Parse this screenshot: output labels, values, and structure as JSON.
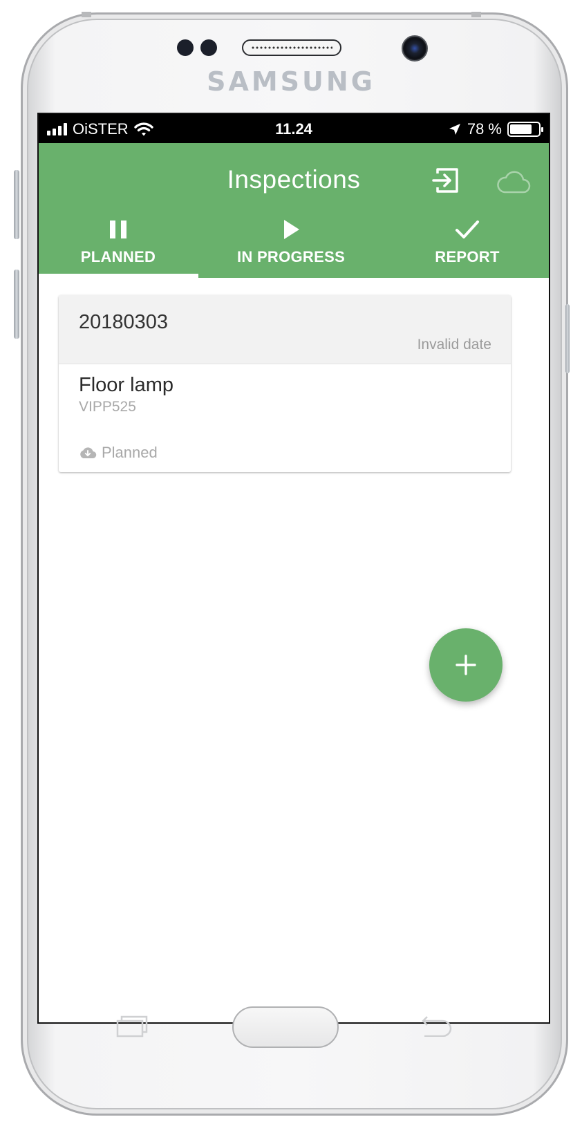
{
  "device": {
    "brand": "SAMSUNG"
  },
  "status_bar": {
    "carrier": "OiSTER",
    "time": "11.24",
    "battery": "78 %",
    "battery_level": 0.78
  },
  "app_bar": {
    "title": "Inspections",
    "login_icon": "login-icon",
    "cloud_icon": "cloud-icon"
  },
  "tabs": [
    {
      "label": "PLANNED",
      "icon": "pause-icon",
      "active": true
    },
    {
      "label": "IN PROGRESS",
      "icon": "play-icon",
      "active": false
    },
    {
      "label": "REPORT",
      "icon": "check-icon",
      "active": false
    }
  ],
  "inspections": [
    {
      "id": "20180303",
      "date": "Invalid date",
      "name": "Floor lamp",
      "code": "VIPP525",
      "status": "Planned",
      "status_icon": "cloud-download-icon"
    }
  ],
  "fab": {
    "icon": "plus-icon"
  },
  "colors": {
    "primary": "#69b16c",
    "card_header": "#f2f2f2",
    "muted_text": "#a8a8a8"
  }
}
